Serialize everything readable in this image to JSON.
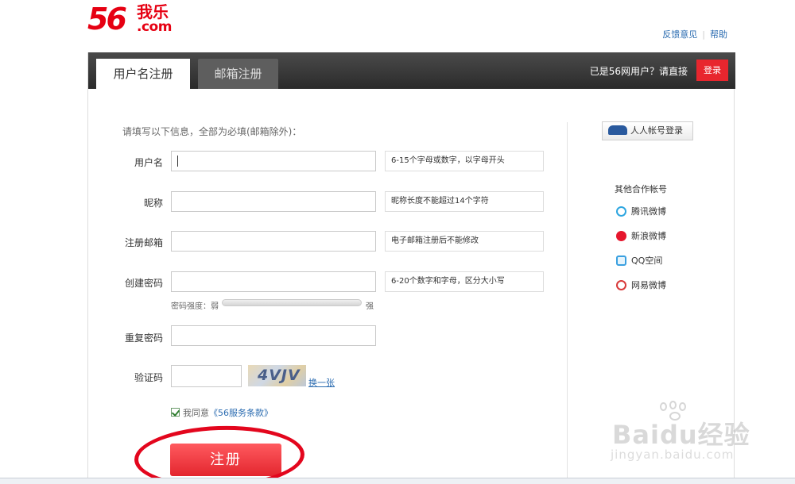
{
  "header": {
    "logo_num": "56",
    "logo_cn": "我乐",
    "logo_com": ".com",
    "links": [
      "反馈意见",
      "帮助"
    ]
  },
  "tabs": {
    "username_register": "用户名注册",
    "email_register": "邮箱注册",
    "already_user": "已是56网用户？请直接",
    "login": "登录"
  },
  "form": {
    "intro": "请填写以下信息，全部为必填(邮箱除外)：",
    "fields": [
      {
        "label": "用户名",
        "hint": "6-15个字母或数字，以字母开头"
      },
      {
        "label": "昵称",
        "hint": "昵称长度不能超过14个字符"
      },
      {
        "label": "注册邮箱",
        "hint": "电子邮箱注册后不能修改"
      },
      {
        "label": "创建密码",
        "hint": "6-20个数字和字母，区分大小写"
      },
      {
        "label": "重复密码"
      },
      {
        "label": "验证码"
      }
    ],
    "strength_label": "密码强度：弱",
    "strength_strong": "强",
    "captcha_text": "4VJV",
    "refresh": "换一张",
    "agree_prefix": "我同意",
    "agree_link": "《56服务条款》",
    "register": "注册"
  },
  "sidebar": {
    "renren_login": "人人帐号登录",
    "partner_title": "其他合作帐号",
    "partners": [
      {
        "name": "腾讯微博",
        "color": "#2ea6e0"
      },
      {
        "name": "新浪微博",
        "color": "#e6162d"
      },
      {
        "name": "QQ空间",
        "color": "#3aa0e0"
      },
      {
        "name": "网易微博",
        "color": "#d83a3a"
      }
    ]
  },
  "watermark": {
    "brand": "Baidu经验",
    "url": "jingyan.baidu.com"
  }
}
